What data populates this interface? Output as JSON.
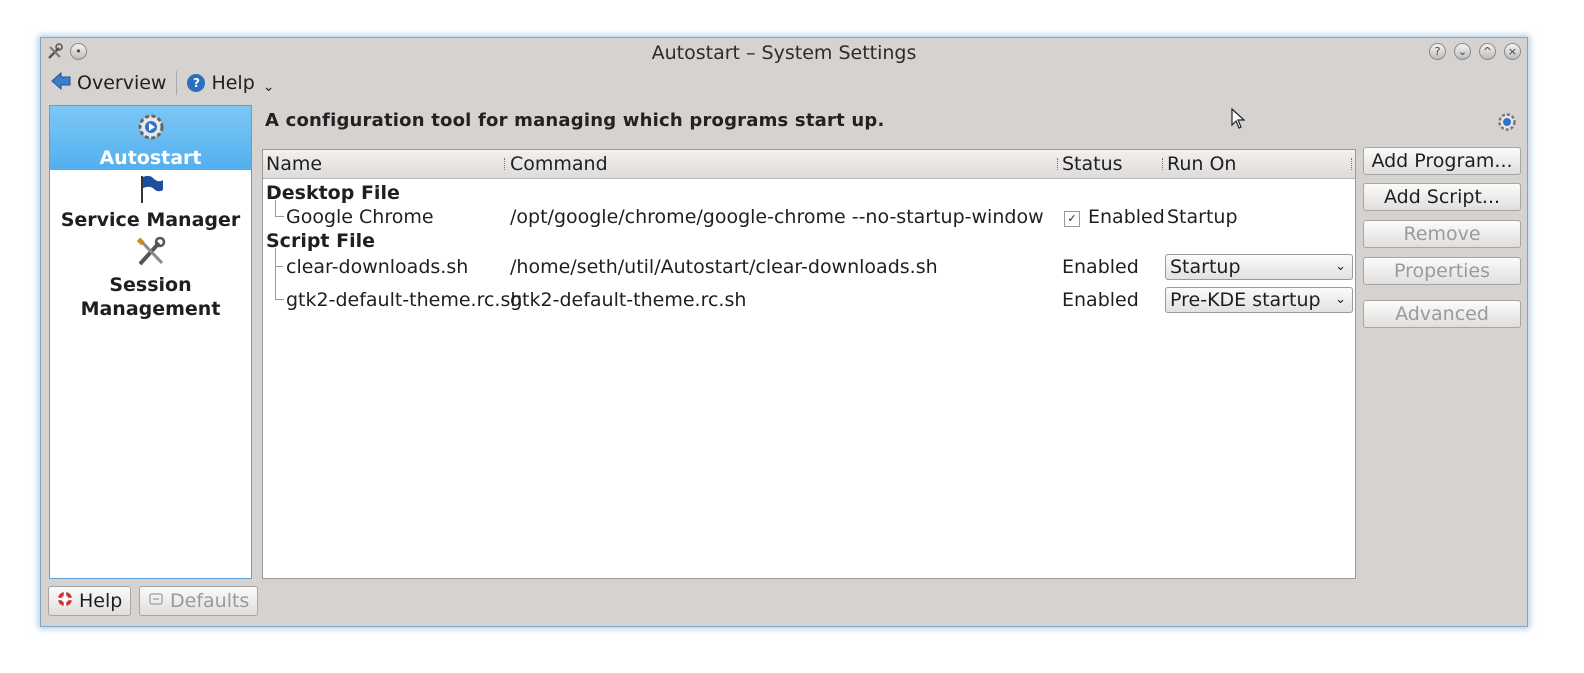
{
  "window": {
    "title": "Autostart – System Settings"
  },
  "toolbar": {
    "overview_label": "Overview",
    "help_label": "Help"
  },
  "sidebar": {
    "items": [
      {
        "label": "Autostart",
        "icon": "gear-icon",
        "active": true
      },
      {
        "label": "Service Manager",
        "icon": "flag-icon",
        "active": false
      },
      {
        "label": "Session Management",
        "icon": "tools-icon",
        "active": false
      }
    ]
  },
  "main": {
    "description": "A configuration tool for managing which programs start up.",
    "columns": [
      "Name",
      "Command",
      "Status",
      "Run On"
    ],
    "groups": [
      {
        "label": "Desktop File",
        "rows": [
          {
            "name": "Google Chrome",
            "command": "/opt/google/chrome/google-chrome --no-startup-window",
            "status": "Enabled",
            "run_on": "Startup",
            "checked": true
          }
        ]
      },
      {
        "label": "Script File",
        "rows": [
          {
            "name": "clear-downloads.sh",
            "command": "/home/seth/util/Autostart/clear-downloads.sh",
            "status": "Enabled",
            "run_on": "Startup"
          },
          {
            "name": "gtk2-default-theme.rc.sh",
            "command": "gtk2-default-theme.rc.sh",
            "status": "Enabled",
            "run_on": "Pre-KDE startup"
          }
        ]
      }
    ]
  },
  "actions": {
    "add_program": "Add Program...",
    "add_script": "Add Script...",
    "remove": "Remove",
    "properties": "Properties",
    "advanced": "Advanced"
  },
  "footer": {
    "help_label": "Help",
    "defaults_label": "Defaults"
  }
}
